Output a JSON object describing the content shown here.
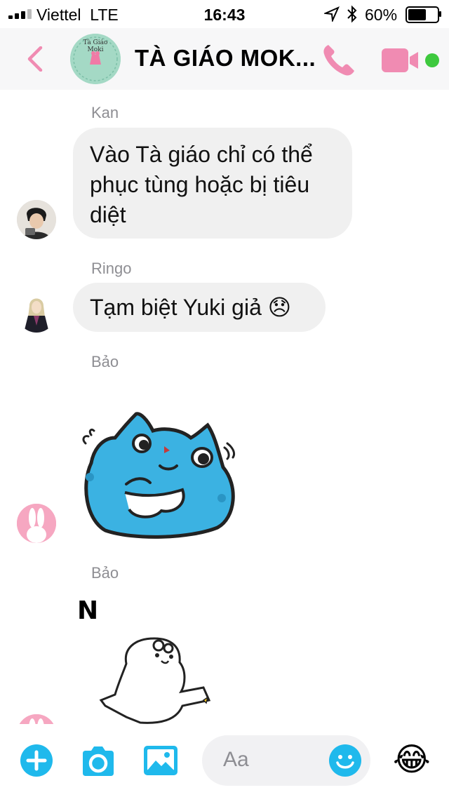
{
  "status_bar": {
    "carrier": "Viettel",
    "network": "LTE",
    "time": "16:43",
    "battery": "60%"
  },
  "header": {
    "group_name": "TÀ GIÁO MOK...",
    "avatar_text": "Tà Giáo Moki"
  },
  "messages": [
    {
      "sender": "Kan",
      "text": "Vào Tà giáo chỉ có thể phục tùng hoặc bị tiêu diệt"
    },
    {
      "sender": "Ringo",
      "text": "Tạm biệt Yuki giả",
      "emoji": "😞"
    },
    {
      "sender": "Bảo",
      "sticker": "blue-cat-sticker"
    },
    {
      "sender": "Bảo",
      "sticker": "white-bear-sticker",
      "sticker_text": "N"
    }
  ],
  "composer": {
    "placeholder": "Aa",
    "reaction_emoji": "😂"
  },
  "colors": {
    "accent_pink": "#f08bb2",
    "icon_blue": "#1fb9ec",
    "online_green": "#3ec93e"
  }
}
